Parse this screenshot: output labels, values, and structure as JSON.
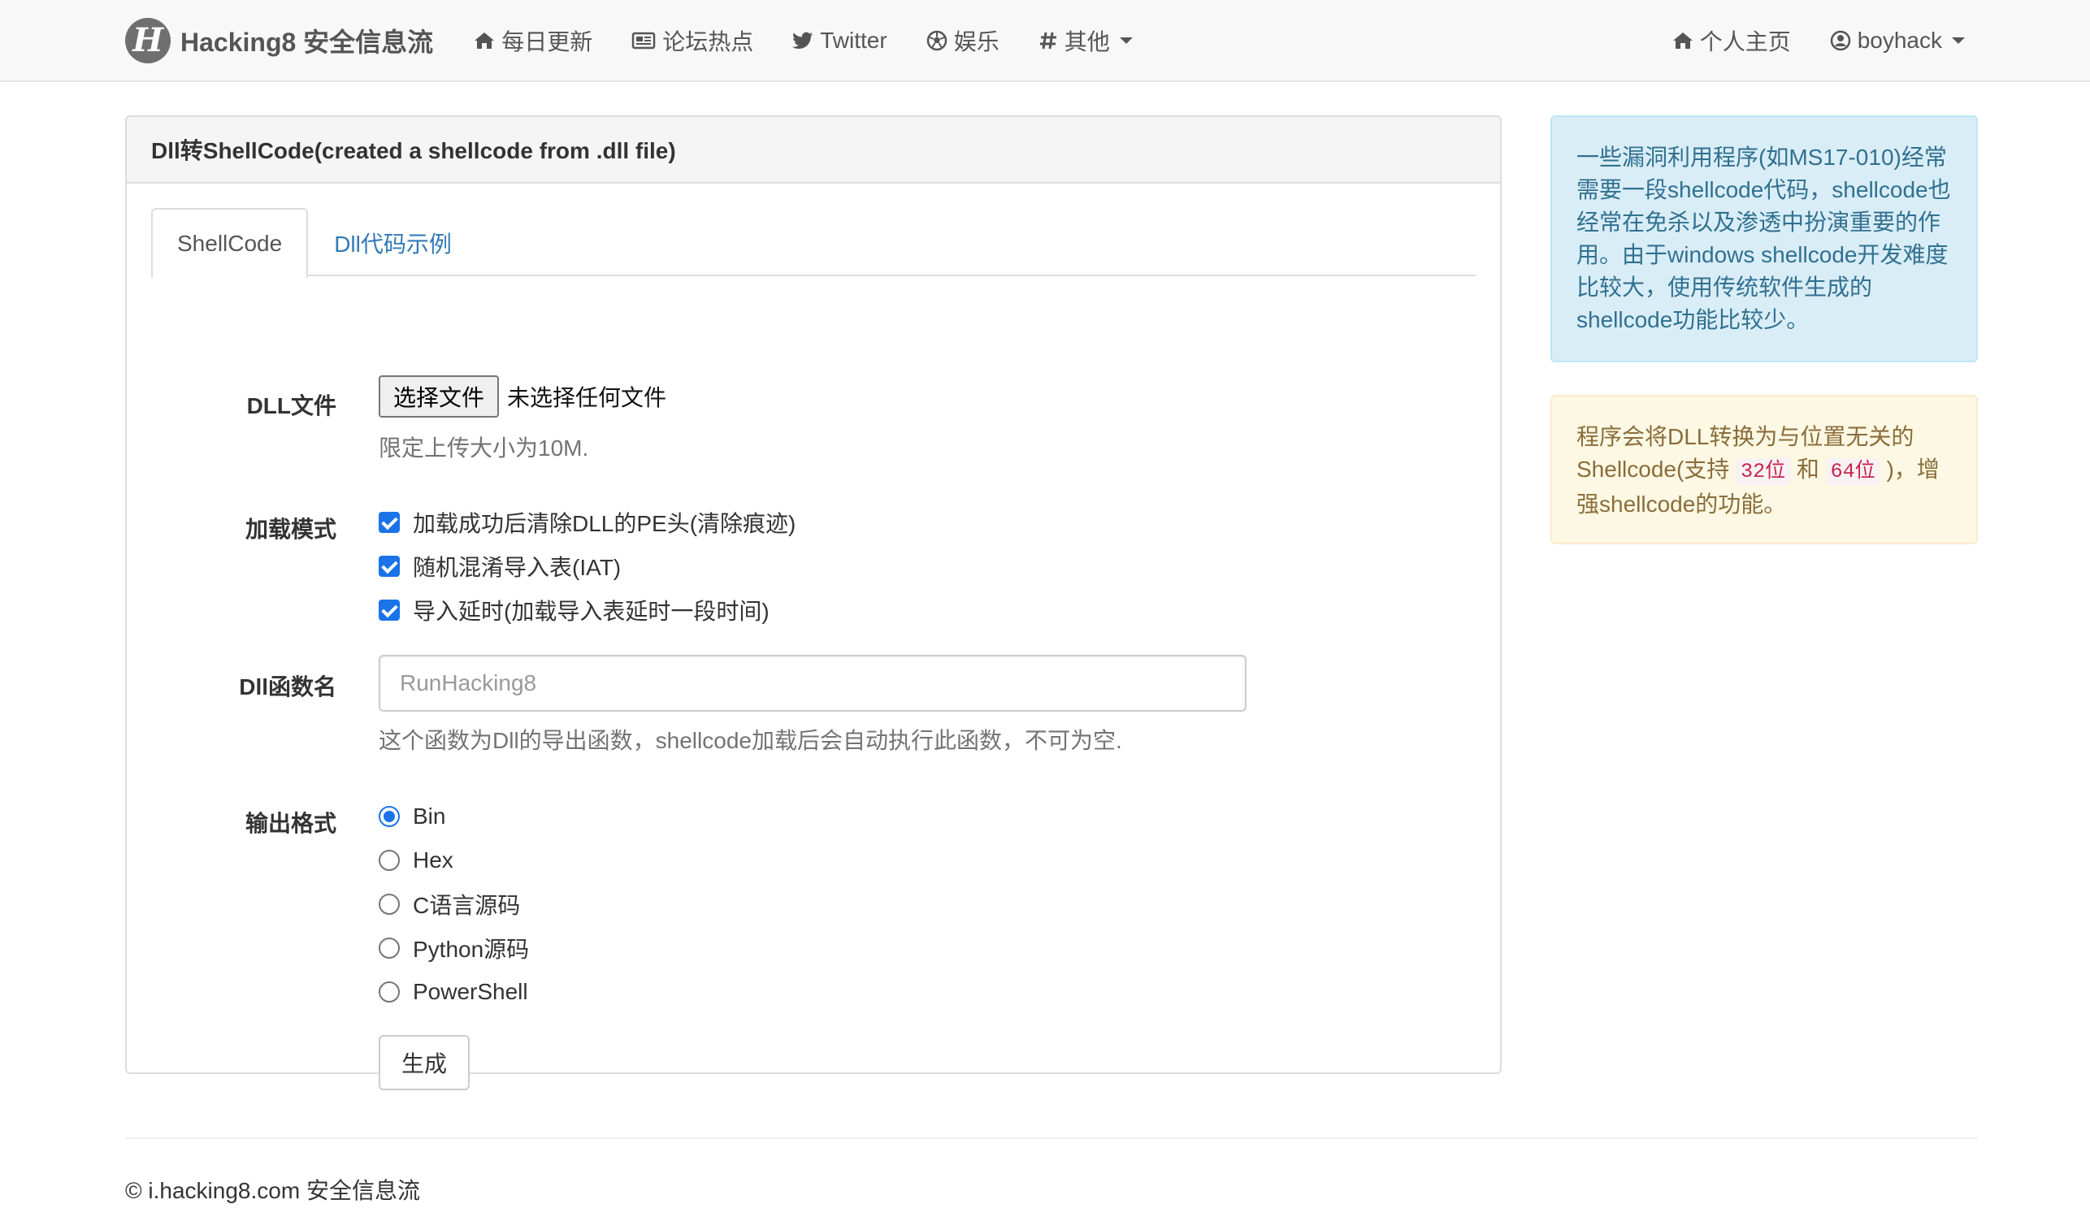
{
  "navbar": {
    "brand": "Hacking8 安全信息流",
    "brand_logo_letter": "H",
    "items": [
      {
        "label": "每日更新",
        "icon": "home-icon"
      },
      {
        "label": "论坛热点",
        "icon": "newspaper-icon"
      },
      {
        "label": "Twitter",
        "icon": "twitter-icon"
      },
      {
        "label": "娱乐",
        "icon": "soccer-ball-icon"
      },
      {
        "label": "其他",
        "icon": "hashtag-icon"
      }
    ],
    "right_items": [
      {
        "label": "个人主页",
        "icon": "home-icon"
      },
      {
        "label": "boyhack",
        "icon": "user-circle-icon"
      }
    ]
  },
  "panel": {
    "title": "Dll转ShellCode(created a shellcode from .dll file)",
    "tabs": [
      {
        "label": "ShellCode",
        "active": true
      },
      {
        "label": "Dll代码示例",
        "active": false
      }
    ]
  },
  "form": {
    "dll_file": {
      "label": "DLL文件",
      "button_label": "选择文件",
      "status": "未选择任何文件",
      "help": "限定上传大小为10M."
    },
    "load_mode": {
      "label": "加载模式",
      "options": [
        {
          "label": "加载成功后清除DLL的PE头(清除痕迹)",
          "checked": true
        },
        {
          "label": "随机混淆导入表(IAT)",
          "checked": true
        },
        {
          "label": "导入延时(加载导入表延时一段时间)",
          "checked": true
        }
      ]
    },
    "func_name": {
      "label": "Dll函数名",
      "value": "",
      "placeholder": "RunHacking8",
      "help": "这个函数为Dll的导出函数，shellcode加载后会自动执行此函数，不可为空."
    },
    "output_format": {
      "label": "输出格式",
      "options": [
        {
          "label": "Bin",
          "selected": true
        },
        {
          "label": "Hex",
          "selected": false
        },
        {
          "label": "C语言源码",
          "selected": false
        },
        {
          "label": "Python源码",
          "selected": false
        },
        {
          "label": "PowerShell",
          "selected": false
        }
      ]
    },
    "submit_label": "生成"
  },
  "sidebar": {
    "info_text": "一些漏洞利用程序(如MS17-010)经常需要一段shellcode代码，shellcode也经常在免杀以及渗透中扮演重要的作用。由于windows shellcode开发难度比较大，使用传统软件生成的shellcode功能比较少。",
    "warning": {
      "prefix": "程序会将DLL转换为与位置无关的Shellcode(支持 ",
      "code1": "32位",
      "middle": " 和 ",
      "code2": "64位",
      "suffix": " )，增强shellcode的功能。"
    }
  },
  "footer": {
    "text": "© i.hacking8.com 安全信息流"
  },
  "colors": {
    "link": "#337ab7",
    "info_bg": "#d9edf7",
    "warning_bg": "#fcf8e3",
    "checkbox": "#1a73e8"
  }
}
